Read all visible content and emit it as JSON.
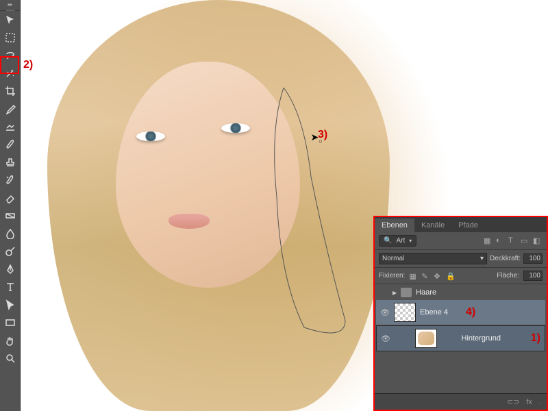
{
  "annotations": {
    "a1": "1)",
    "a2": "2)",
    "a3": "3)",
    "a4": "4)"
  },
  "panel": {
    "tabs": {
      "layers": "Ebenen",
      "channels": "Kanäle",
      "paths": "Pfade"
    },
    "filter": "Art",
    "blend_mode": "Normal",
    "opacity_label": "Deckkraft:",
    "opacity_value": "100",
    "lock_label": "Fixieren:",
    "fill_label": "Fläche:",
    "fill_value": "100",
    "group_name": "Haare",
    "layers": [
      {
        "name": "Ebene 4",
        "visible": true
      },
      {
        "name": "Hintergrund",
        "visible": true
      }
    ],
    "footer_link": "⊂⊃",
    "footer_fx": "fx"
  }
}
